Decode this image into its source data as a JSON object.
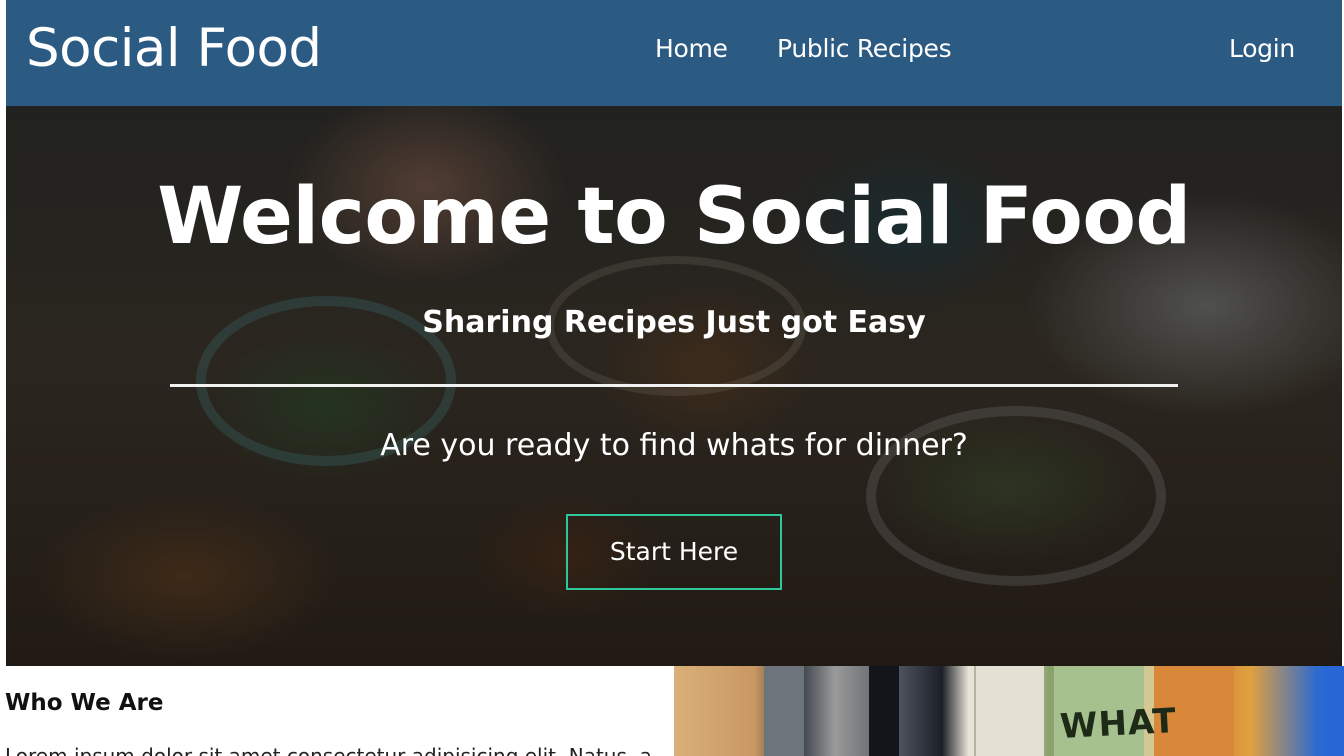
{
  "navbar": {
    "brand": "Social Food",
    "links": [
      {
        "label": "Home"
      },
      {
        "label": "Public Recipes"
      }
    ],
    "login_label": "Login",
    "background": "#2b5a82"
  },
  "hero": {
    "title": "Welcome to Social Food",
    "subtitle": "Sharing Recipes Just got Easy",
    "question": "Are you ready to find whats for dinner?",
    "button_label": "Start Here",
    "button_border_color": "#2ec79a"
  },
  "about": {
    "heading": "Who We Are",
    "text": "Lorem ipsum dolor sit amet consectetur adipisicing elit. Natus, a"
  },
  "about_image": {
    "label": "WHAT"
  }
}
